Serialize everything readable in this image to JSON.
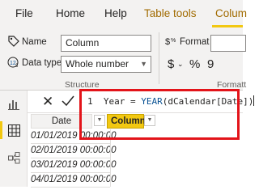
{
  "tabs": [
    {
      "label": "File"
    },
    {
      "label": "Home"
    },
    {
      "label": "Help"
    },
    {
      "label": "Table tools"
    },
    {
      "label": "Colum"
    }
  ],
  "structure": {
    "name_label": "Name",
    "name_value": "Column",
    "datatype_label": "Data type",
    "datatype_value": "Whole number",
    "group_label": "Structure"
  },
  "formatting": {
    "format_label": "Format",
    "currency_symbol": "$",
    "percent_symbol": "%",
    "comma_symbol": "9",
    "group_label": "Formatt"
  },
  "formula": {
    "line_number": "1",
    "text_before": "Year = ",
    "function": "YEAR",
    "text_after": "(dCalendar[Date])"
  },
  "table": {
    "columns": [
      "Date",
      "Column"
    ],
    "rows": [
      "01/01/2019 00:00:00",
      "02/01/2019 00:00:00",
      "03/01/2019 00:00:00",
      "04/01/2019 00:00:00"
    ]
  },
  "colors": {
    "accent": "#f2c811",
    "active_tab_text": "#a16b00",
    "highlight_border": "#e3141a"
  },
  "icons": [
    "name-tag-icon",
    "data-type-icon",
    "format-icon",
    "report-view-icon",
    "data-view-icon",
    "model-view-icon",
    "cancel-icon",
    "commit-icon",
    "dropdown-icon"
  ]
}
